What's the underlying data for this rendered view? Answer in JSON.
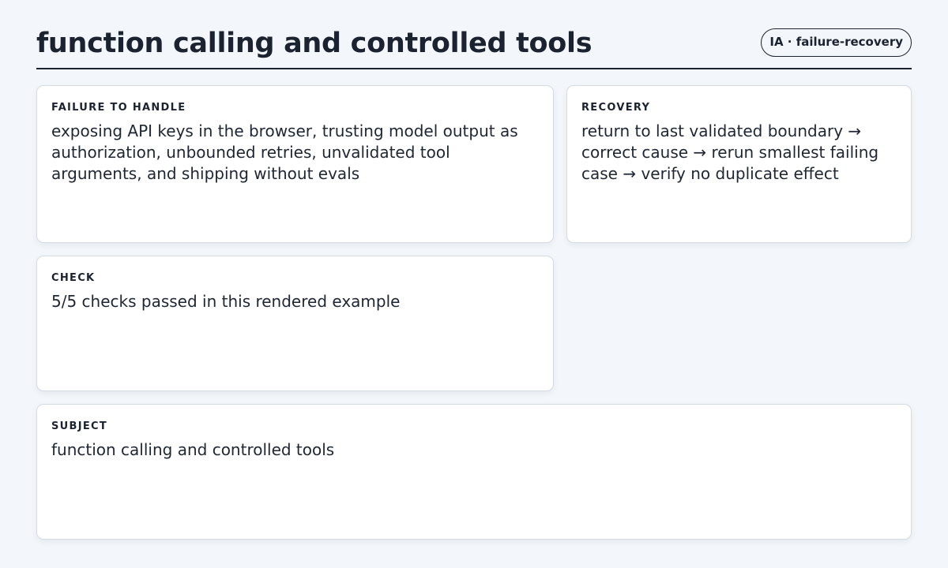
{
  "header": {
    "title": "function calling and controlled tools",
    "badge": "IA · failure-recovery"
  },
  "cards": {
    "failure": {
      "label": "FAILURE TO HANDLE",
      "body": "exposing API keys in the browser, trusting model output as authorization, unbounded retries, unvalidated tool arguments, and shipping without evals"
    },
    "recovery": {
      "label": "RECOVERY",
      "body": "return to last validated boundary → correct cause → rerun smallest failing case → verify no duplicate effect"
    },
    "check": {
      "label": "CHECK",
      "body": "5/5 checks passed in this rendered example"
    },
    "subject": {
      "label": "SUBJECT",
      "body": "function calling and controlled tools"
    }
  }
}
